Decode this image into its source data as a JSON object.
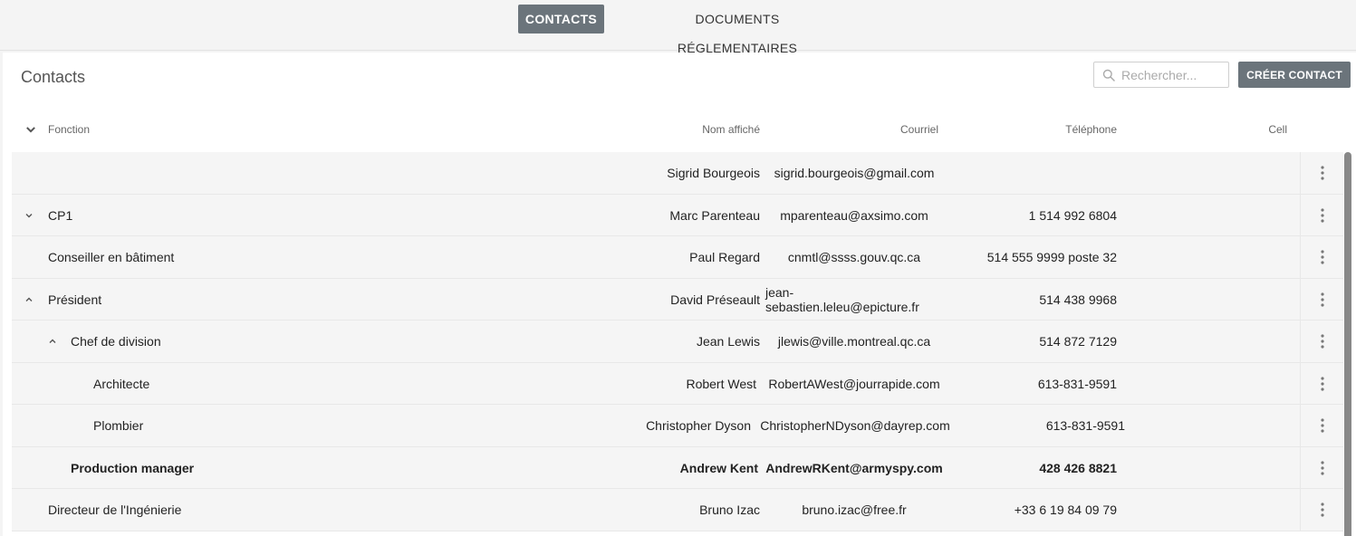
{
  "nav": {
    "tabs": [
      {
        "label": "CONTACTS",
        "active": true
      },
      {
        "label": "DOCUMENTS RÉGLEMENTAIRES",
        "active": false
      }
    ]
  },
  "panel": {
    "title": "Contacts",
    "search_placeholder": "Rechercher...",
    "create_label": "CRÉER CONTACT"
  },
  "table": {
    "headers": {
      "fonction": "Fonction",
      "nom": "Nom affiché",
      "courriel": "Courriel",
      "telephone": "Téléphone",
      "cell": "Cell"
    },
    "rows": [
      {
        "fonction": "",
        "nom": "Sigrid Bourgeois",
        "courriel": "sigrid.bourgeois@gmail.com",
        "telephone": "",
        "cell": ""
      },
      {
        "fonction": "CP1",
        "nom": "Marc Parenteau",
        "courriel": "mparenteau@axsimo.com",
        "telephone": "1 514 992 6804",
        "cell": "",
        "toggle": "collapsed"
      },
      {
        "fonction": "Conseiller en bâtiment",
        "nom": "Paul Regard",
        "courriel": "cnmtl@ssss.gouv.qc.ca",
        "telephone": "514 555 9999 poste 32",
        "cell": ""
      },
      {
        "fonction": "Président",
        "nom": "David Préseault",
        "courriel": "jean-sebastien.leleu@epicture.fr",
        "telephone": "514 438 9968",
        "cell": "",
        "toggle": "expanded"
      },
      {
        "fonction": "Chef de division",
        "nom": "Jean Lewis",
        "courriel": "jlewis@ville.montreal.qc.ca",
        "telephone": "514 872 7129",
        "cell": "",
        "toggle": "expanded"
      },
      {
        "fonction": "Architecte",
        "nom": "Robert West",
        "courriel": "RobertAWest@jourrapide.com",
        "telephone": "613-831-9591",
        "cell": ""
      },
      {
        "fonction": "Plombier",
        "nom": "Christopher Dyson",
        "courriel": "ChristopherNDyson@dayrep.com",
        "telephone": "613-831-9591",
        "cell": ""
      },
      {
        "fonction": "Production manager",
        "nom": "Andrew Kent",
        "courriel": "AndrewRKent@armyspy.com",
        "telephone": "428 426 8821",
        "cell": "",
        "bold": true
      },
      {
        "fonction": "Directeur de l'Ingénierie",
        "nom": "Bruno Izac",
        "courriel": "bruno.izac@free.fr",
        "telephone": "+33 6 19 84 09 79",
        "cell": ""
      }
    ]
  },
  "icons": {
    "search": "search-icon",
    "toggle_collapsed": "chevron-down-icon",
    "toggle_expanded": "chevron-up-icon",
    "row_menu": "more-vert-icon"
  },
  "colors": {
    "accent": "#6b747b",
    "row_bg": "#f5f5f5",
    "panel_bg": "#ffffff",
    "page_bg": "#f4f4f4"
  }
}
